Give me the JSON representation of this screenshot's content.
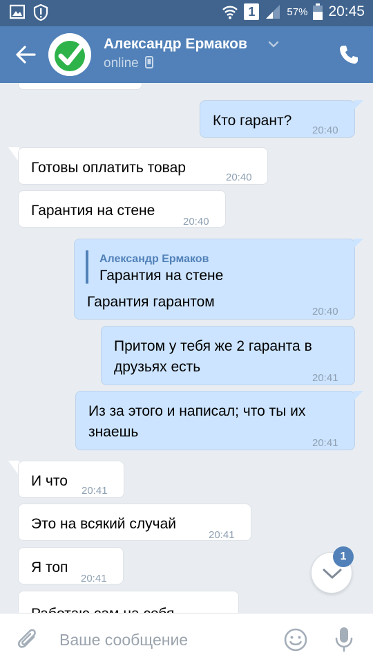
{
  "status_bar": {
    "battery_percent": "57%",
    "time": "20:45",
    "sim_slot": "1",
    "icons": [
      "gallery-icon",
      "alert-icon",
      "wifi-icon",
      "sim-icon",
      "signal-icon",
      "battery-icon"
    ]
  },
  "header": {
    "contact_name": "Александр Ермаков",
    "status": "online",
    "avatar_icon": "checkmark-badge-icon",
    "colors": {
      "bar": "#5181b8",
      "status_bar": "#41648e"
    }
  },
  "messages": [
    {
      "id": "m0",
      "direction": "in",
      "text": "",
      "time": ""
    },
    {
      "id": "m1",
      "direction": "out",
      "text": "Кто гарант?",
      "time": "20:40"
    },
    {
      "id": "m2",
      "direction": "in",
      "text": "Готовы оплатить товар",
      "time": "20:40"
    },
    {
      "id": "m3",
      "direction": "in",
      "text": "Гарантия на стене",
      "time": "20:40"
    },
    {
      "id": "m4",
      "direction": "out",
      "reply_author": "Александр Ермаков",
      "reply_text": "Гарантия на стене",
      "text": "Гарантия гарантом",
      "time": "20:40"
    },
    {
      "id": "m5",
      "direction": "out",
      "text": "Притом у тебя же 2 гаранта в друзьях есть",
      "time": "20:41"
    },
    {
      "id": "m6",
      "direction": "out",
      "text": "Из за этого и написал; что ты их знаешь",
      "time": "20:41"
    },
    {
      "id": "m7",
      "direction": "in",
      "text": "И что",
      "time": "20:41"
    },
    {
      "id": "m8",
      "direction": "in",
      "text": "Это на всякий случай",
      "time": "20:41"
    },
    {
      "id": "m9",
      "direction": "in",
      "text": "Я топ",
      "time": "20:41"
    },
    {
      "id": "m10",
      "direction": "in",
      "text": "Работаю сам на себя",
      "time": ""
    }
  ],
  "scroll_down": {
    "unread_count": "1"
  },
  "composer": {
    "placeholder": "Ваше сообщение",
    "icons": [
      "paperclip-icon",
      "emoji-icon",
      "microphone-icon"
    ]
  },
  "colors": {
    "outgoing_bubble": "#cce4ff",
    "incoming_bubble": "#ffffff",
    "chat_bg": "#e9edf1",
    "time_text": "#8fa1b3"
  }
}
